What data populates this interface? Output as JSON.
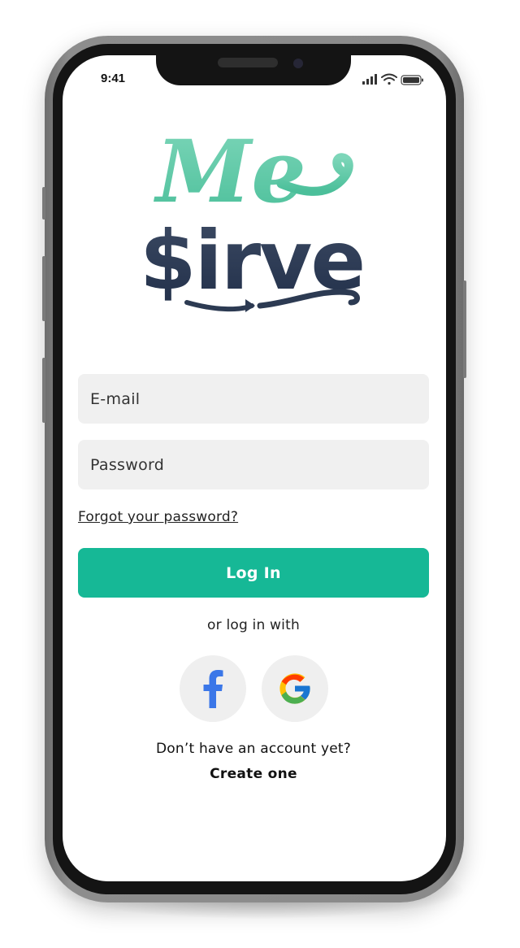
{
  "status_bar": {
    "time": "9:41"
  },
  "logo": {
    "line1": "Me",
    "line2": "$irve",
    "colors": {
      "top": "#5ec7a4",
      "bottom": "#2c3a52"
    }
  },
  "form": {
    "email_placeholder": "E-mail",
    "password_placeholder": "Password",
    "forgot_link": "Forgot your password?",
    "login_button": "Log In"
  },
  "social": {
    "label": "or log in with",
    "providers": [
      {
        "name": "facebook",
        "icon": "facebook-icon"
      },
      {
        "name": "google",
        "icon": "google-icon"
      }
    ]
  },
  "signup": {
    "prompt": "Don’t have an account yet?",
    "link": "Create one"
  },
  "colors": {
    "accent": "#16b896",
    "field_bg": "#f0f0f0",
    "social_bg": "#efefef",
    "frame": "#141414"
  }
}
